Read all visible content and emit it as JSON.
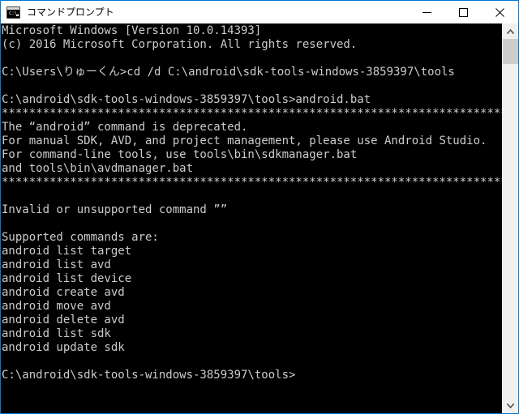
{
  "window": {
    "title": "コマンドプロンプト",
    "icon": "cmd-prompt-icon",
    "icon_prompt_text": "C:\\.",
    "border_color": "#0078d7",
    "titlebar_bg": "#ffffff",
    "console_bg": "#000000",
    "console_fg": "#cccccc"
  },
  "window_buttons": {
    "minimize": "minimize-icon",
    "maximize": "maximize-icon",
    "close": "close-icon"
  },
  "scrollbar": {
    "up_arrow": "chevron-up-icon",
    "down_arrow": "chevron-down-icon",
    "thumb_color": "#cdcdcd",
    "track_color": "#f0f0f0"
  },
  "console": {
    "lines": [
      "Microsoft Windows [Version 10.0.14393]",
      "(c) 2016 Microsoft Corporation. All rights reserved.",
      "",
      "C:\\Users\\りゅーくん>cd /d C:\\android\\sdk-tools-windows-3859397\\tools",
      "",
      "C:\\android\\sdk-tools-windows-3859397\\tools>android.bat",
      "***************************************************************************",
      "The “android” command is deprecated.",
      "For manual SDK, AVD, and project management, please use Android Studio.",
      "For command-line tools, use tools\\bin\\sdkmanager.bat",
      "and tools\\bin\\avdmanager.bat",
      "***************************************************************************",
      "",
      "Invalid or unsupported command ””",
      "",
      "Supported commands are:",
      "android list target",
      "android list avd",
      "android list device",
      "android create avd",
      "android move avd",
      "android delete avd",
      "android list sdk",
      "android update sdk",
      "",
      "C:\\android\\sdk-tools-windows-3859397\\tools>"
    ]
  }
}
